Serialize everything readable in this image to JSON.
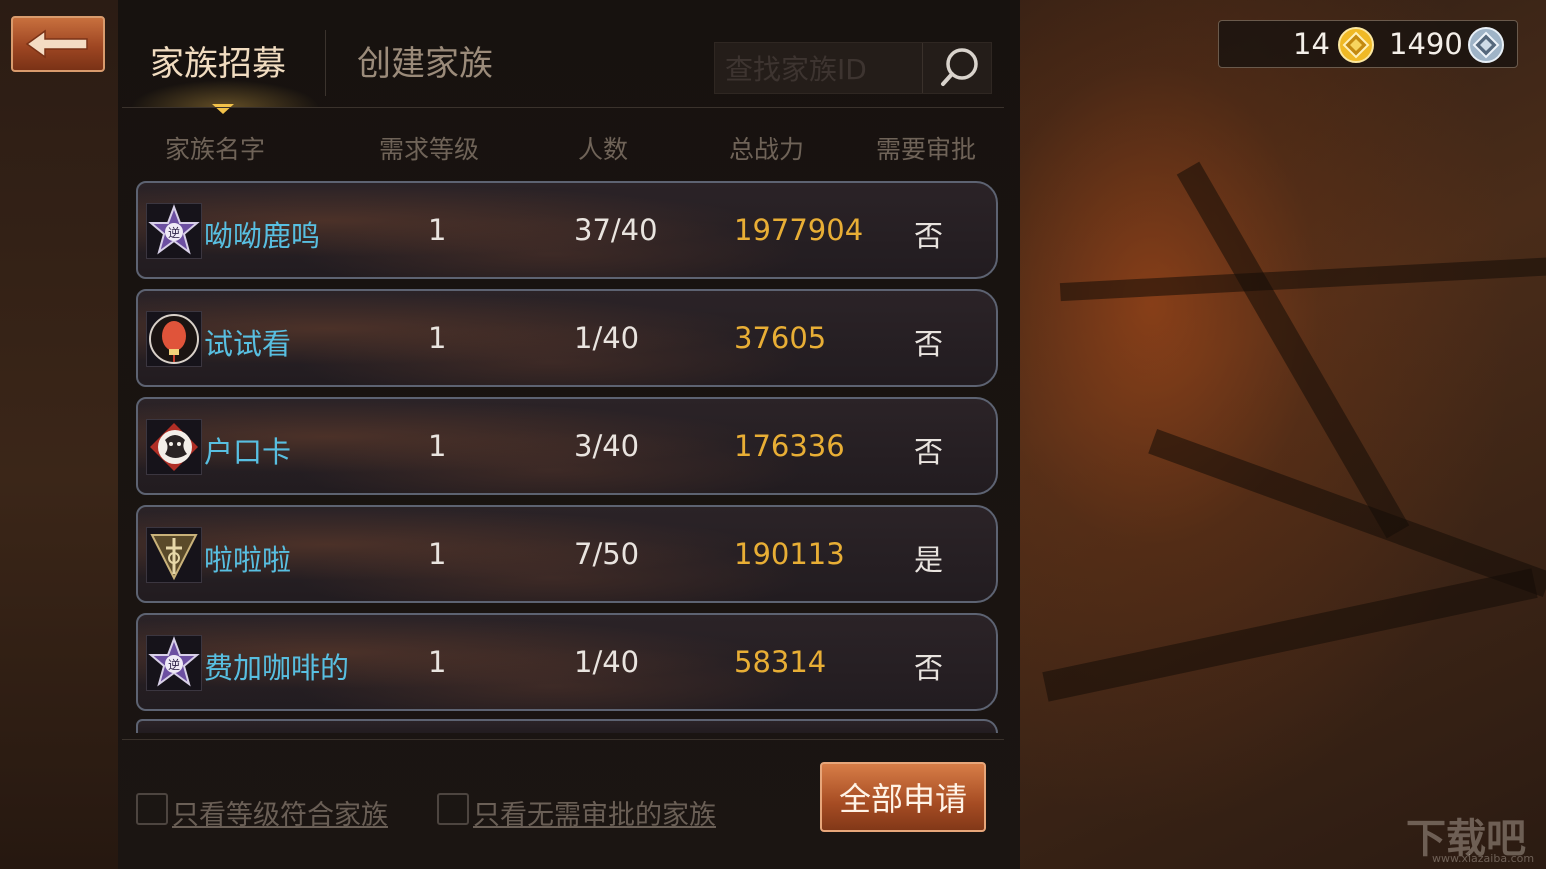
{
  "tabs": {
    "recruit": "家族招募",
    "create": "创建家族"
  },
  "search": {
    "placeholder": "查找家族ID",
    "value": ""
  },
  "columns": [
    "家族名字",
    "需求等级",
    "人数",
    "总战力",
    "需要审批"
  ],
  "families": [
    {
      "name": "呦呦鹿鸣",
      "level": "1",
      "members": "37/40",
      "power": "1977904",
      "approval": "否",
      "emblem": "star-emblem-icon"
    },
    {
      "name": "试试看",
      "level": "1",
      "members": "1/40",
      "power": "37605",
      "approval": "否",
      "emblem": "lantern-emblem-icon"
    },
    {
      "name": "户口卡",
      "level": "1",
      "members": "3/40",
      "power": "176336",
      "approval": "否",
      "emblem": "tiger-emblem-icon"
    },
    {
      "name": "啦啦啦",
      "level": "1",
      "members": "7/50",
      "power": "190113",
      "approval": "是",
      "emblem": "sword-emblem-icon"
    },
    {
      "name": "费加咖啡的",
      "level": "1",
      "members": "1/40",
      "power": "58314",
      "approval": "否",
      "emblem": "star-emblem-icon"
    }
  ],
  "filters": {
    "level_match": {
      "label": "只看等级符合家族",
      "checked": false
    },
    "no_approval": {
      "label": "只看无需审批的家族",
      "checked": false
    }
  },
  "apply_all_label": "全部申请",
  "currency": {
    "gold": "14",
    "silver": "1490",
    "gold_icon": "gold-coin-icon",
    "silver_icon": "silver-coin-icon"
  },
  "watermark": {
    "text": "下载吧",
    "url_text": "www.xiazaiba.com"
  },
  "colors": {
    "name": "#58bfe1",
    "power": "#e8ae35",
    "button": "#a64c23",
    "tab_active": "#f1dcc0"
  }
}
